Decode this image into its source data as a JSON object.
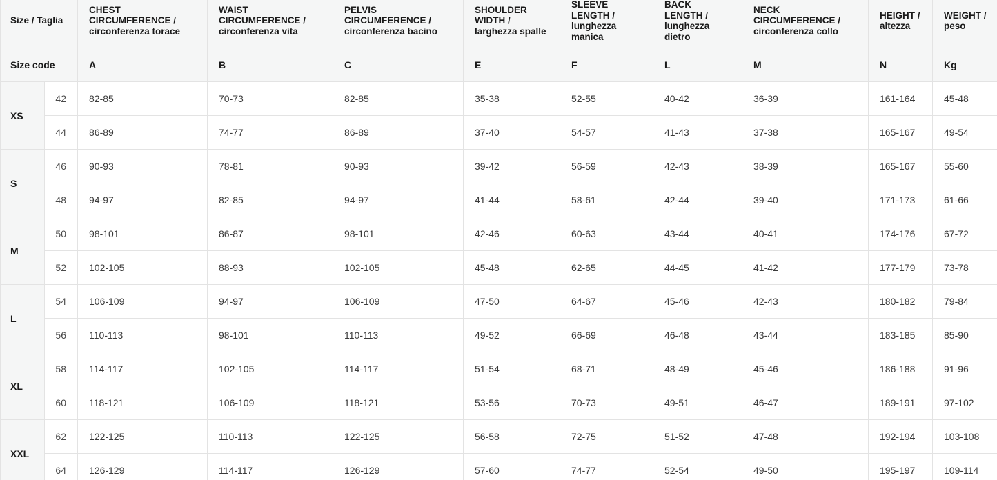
{
  "headers": [
    "Size / Taglia",
    "CHEST CIRCUMFERENCE / circonferenza torace",
    "WAIST CIRCUMFERENCE / circonferenza vita",
    "PELVIS CIRCUMFERENCE / circonferenza bacino",
    "SHOULDER WIDTH / larghezza spalle",
    "SLEEVE LENGTH / lunghezza manica",
    "BACK LENGTH / lunghezza dietro",
    "NECK CIRCUMFERENCE / circonferenza collo",
    "HEIGHT / altezza",
    "WEIGHT / peso"
  ],
  "codes": [
    "Size code",
    "A",
    "B",
    "C",
    "E",
    "F",
    "L",
    "M",
    "N",
    "Kg"
  ],
  "groups": [
    {
      "label": "XS",
      "rows": [
        {
          "num": "42",
          "values": [
            "82-85",
            "70-73",
            "82-85",
            "35-38",
            "52-55",
            "40-42",
            "36-39",
            "161-164",
            "45-48"
          ]
        },
        {
          "num": "44",
          "values": [
            "86-89",
            "74-77",
            "86-89",
            "37-40",
            "54-57",
            "41-43",
            "37-38",
            "165-167",
            "49-54"
          ]
        }
      ]
    },
    {
      "label": "S",
      "rows": [
        {
          "num": "46",
          "values": [
            "90-93",
            "78-81",
            "90-93",
            "39-42",
            "56-59",
            "42-43",
            "38-39",
            "165-167",
            "55-60"
          ]
        },
        {
          "num": "48",
          "values": [
            "94-97",
            "82-85",
            "94-97",
            "41-44",
            "58-61",
            "42-44",
            "39-40",
            "171-173",
            "61-66"
          ]
        }
      ]
    },
    {
      "label": "M",
      "rows": [
        {
          "num": "50",
          "values": [
            "98-101",
            "86-87",
            "98-101",
            "42-46",
            "60-63",
            "43-44",
            "40-41",
            "174-176",
            "67-72"
          ]
        },
        {
          "num": "52",
          "values": [
            "102-105",
            "88-93",
            "102-105",
            "45-48",
            "62-65",
            "44-45",
            "41-42",
            "177-179",
            "73-78"
          ]
        }
      ]
    },
    {
      "label": "L",
      "rows": [
        {
          "num": "54",
          "values": [
            "106-109",
            "94-97",
            "106-109",
            "47-50",
            "64-67",
            "45-46",
            "42-43",
            "180-182",
            "79-84"
          ]
        },
        {
          "num": "56",
          "values": [
            "110-113",
            "98-101",
            "110-113",
            "49-52",
            "66-69",
            "46-48",
            "43-44",
            "183-185",
            "85-90"
          ]
        }
      ]
    },
    {
      "label": "XL",
      "rows": [
        {
          "num": "58",
          "values": [
            "114-117",
            "102-105",
            "114-117",
            "51-54",
            "68-71",
            "48-49",
            "45-46",
            "186-188",
            "91-96"
          ]
        },
        {
          "num": "60",
          "values": [
            "118-121",
            "106-109",
            "118-121",
            "53-56",
            "70-73",
            "49-51",
            "46-47",
            "189-191",
            "97-102"
          ]
        }
      ]
    },
    {
      "label": "XXL",
      "rows": [
        {
          "num": "62",
          "values": [
            "122-125",
            "110-113",
            "122-125",
            "56-58",
            "72-75",
            "51-52",
            "47-48",
            "192-194",
            "103-108"
          ]
        },
        {
          "num": "64",
          "values": [
            "126-129",
            "114-117",
            "126-129",
            "57-60",
            "74-77",
            "52-54",
            "49-50",
            "195-197",
            "109-114"
          ]
        }
      ]
    }
  ]
}
